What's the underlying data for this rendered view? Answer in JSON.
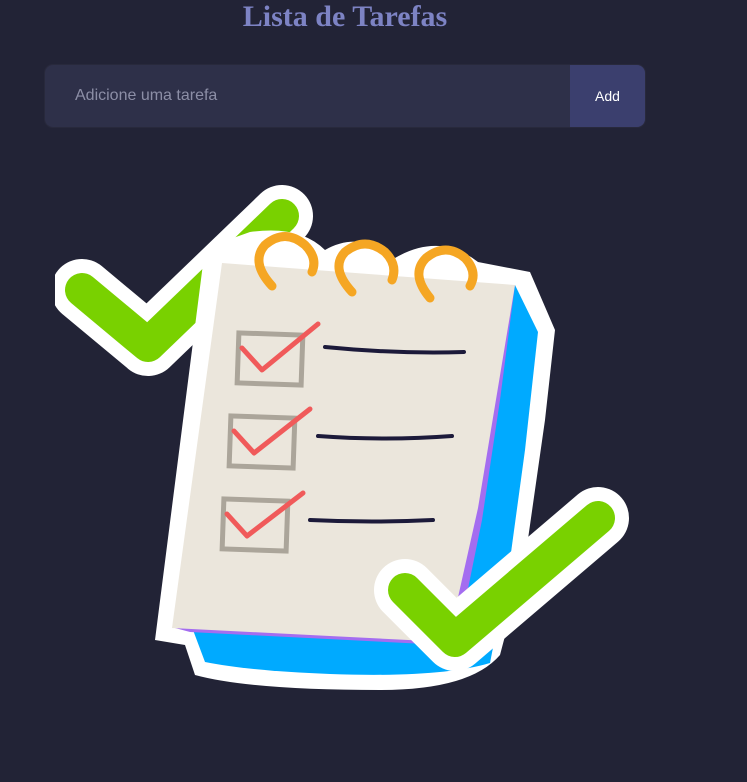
{
  "header": {
    "title": "Lista de Tarefas"
  },
  "task_form": {
    "placeholder": "Adicione uma tarefa",
    "value": "",
    "add_label": "Add"
  },
  "illustration": {
    "icon": "checklist-notepad-illustration"
  },
  "colors": {
    "background": "#222336",
    "title": "#7d83c4",
    "input_background": "#2e3049",
    "button_background": "#3b3f6e",
    "check_green": "#79d100",
    "ring_orange": "#f5a623",
    "paper": "#ebe6dc",
    "notebook_blue": "#00aaff",
    "notebook_purple": "#a46df0",
    "tick_red": "#f05a5a"
  }
}
